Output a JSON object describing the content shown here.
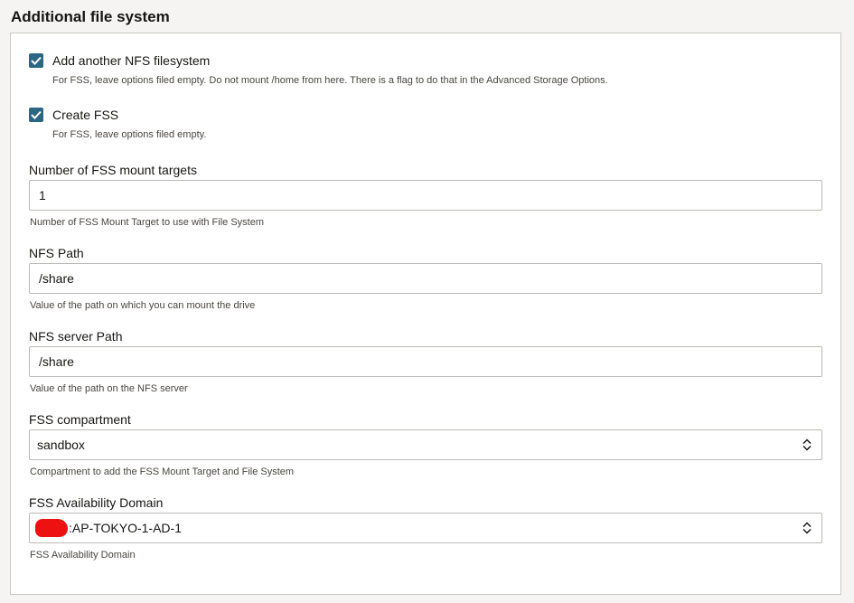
{
  "section": {
    "title": "Additional file system"
  },
  "nfs_checkbox": {
    "checked": true,
    "label": "Add another NFS filesystem",
    "help": "For FSS, leave options filed empty. Do not mount /home from here. There is a flag to do that in the Advanced Storage Options."
  },
  "fss_checkbox": {
    "checked": true,
    "label": "Create FSS",
    "help": "For FSS, leave options filed empty."
  },
  "mount_targets": {
    "label": "Number of FSS mount targets",
    "value": "1",
    "help": "Number of FSS Mount Target to use with File System"
  },
  "nfs_path": {
    "label": "NFS Path",
    "value": "/share",
    "help": "Value of the path on which you can mount the drive"
  },
  "nfs_server_path": {
    "label": "NFS server Path",
    "value": "/share",
    "help": "Value of the path on the NFS server"
  },
  "fss_compartment": {
    "label": "FSS compartment",
    "value": "sandbox",
    "help": "Compartment to add the FSS Mount Target and File System"
  },
  "fss_ad": {
    "label": "FSS Availability Domain",
    "value": ":AP-TOKYO-1-AD-1",
    "help": "FSS Availability Domain"
  },
  "colors": {
    "checkbox": "#2b6684",
    "redaction": "#ee1111"
  }
}
